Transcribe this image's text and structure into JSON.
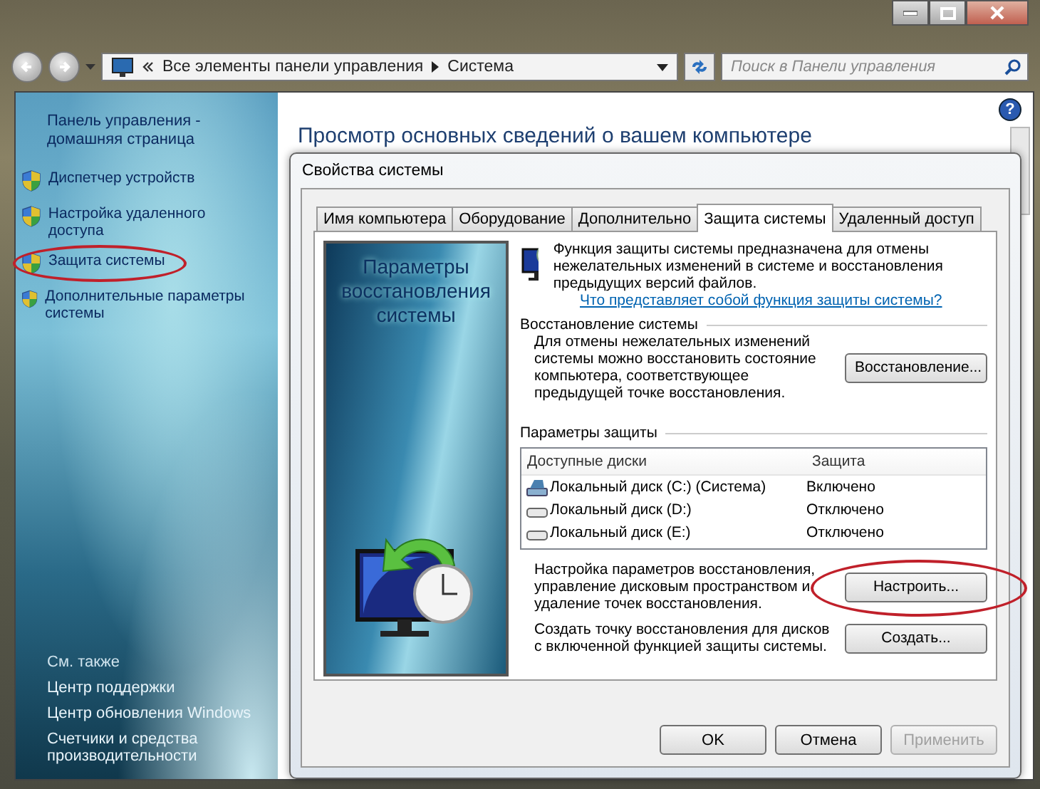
{
  "address_bar": {
    "path": [
      "Все элементы панели управления",
      "Система"
    ]
  },
  "search": {
    "placeholder": "Поиск в Панели управления"
  },
  "sidebar": {
    "home_link": "Панель управления - домашняя страница",
    "items": [
      {
        "label": "Диспетчер устройств",
        "circled": false
      },
      {
        "label": "Настройка удаленного доступа",
        "circled": false
      },
      {
        "label": "Защита системы",
        "circled": true
      },
      {
        "label": "Дополнительные параметры системы",
        "circled": false
      }
    ],
    "see_also": {
      "title": "См. также",
      "items": [
        "Центр поддержки",
        "Центр обновления Windows",
        "Счетчики и средства производительности"
      ]
    }
  },
  "main": {
    "heading": "Просмотр основных сведений о вашем компьютере",
    "help_button": "?"
  },
  "dialog": {
    "title": "Свойства системы",
    "tabs": [
      {
        "label": "Имя компьютера",
        "selected": false
      },
      {
        "label": "Оборудование",
        "selected": false
      },
      {
        "label": "Дополнительно",
        "selected": false
      },
      {
        "label": "Защита системы",
        "selected": true
      },
      {
        "label": "Удаленный доступ",
        "selected": false
      }
    ],
    "banner_text": "Параметры восстановления системы",
    "intro": "Функция защиты системы предназначена для отмены нежелательных изменений в системе и восстановления предыдущих версий файлов.",
    "help_link": "Что представляет собой функция защиты системы?",
    "restore_section": {
      "title": "Восстановление системы",
      "text": "Для отмены нежелательных изменений системы можно восстановить состояние компьютера, соответствующее предыдущей точке восстановления.",
      "button": "Восстановление..."
    },
    "protection_section": {
      "title": "Параметры защиты",
      "columns": [
        "Доступные диски",
        "Защита"
      ],
      "rows": [
        {
          "kind": "system",
          "drive": "Локальный диск (C:) (Система)",
          "protection": "Включено"
        },
        {
          "kind": "drive",
          "drive": "Локальный диск (D:)",
          "protection": "Отключено"
        },
        {
          "kind": "drive",
          "drive": "Локальный диск (E:)",
          "protection": "Отключено"
        }
      ],
      "configure": {
        "text": "Настройка параметров восстановления, управление дисковым пространством и удаление точек восстановления.",
        "button": "Настроить...",
        "circled": true
      },
      "create": {
        "text": "Создать точку восстановления для дисков с включенной функцией защиты системы.",
        "button": "Создать...",
        "circled": false
      }
    },
    "buttons": [
      {
        "label": "OK",
        "disabled": false
      },
      {
        "label": "Отмена",
        "disabled": false
      },
      {
        "label": "Применить",
        "disabled": true
      }
    ]
  }
}
